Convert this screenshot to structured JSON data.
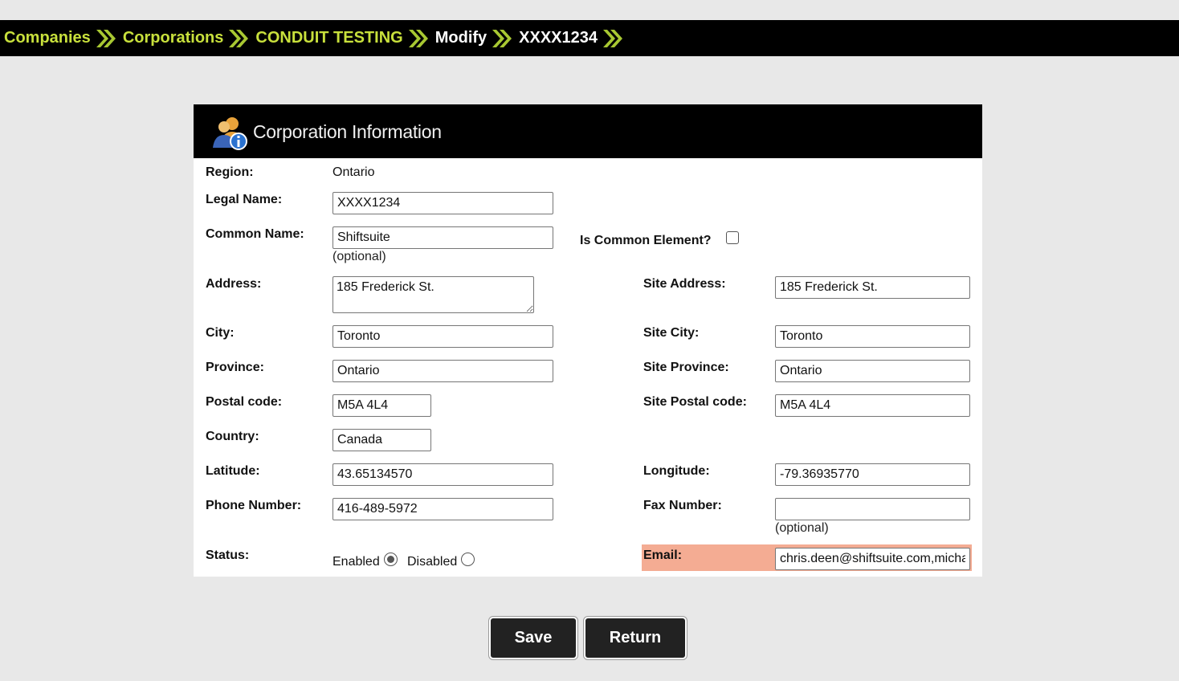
{
  "breadcrumb": [
    {
      "label": "Companies",
      "current": false
    },
    {
      "label": "Corporations",
      "current": false
    },
    {
      "label": "CONDUIT TESTING",
      "current": false
    },
    {
      "label": "Modify",
      "current": true
    },
    {
      "label": "XXXX1234",
      "current": true
    }
  ],
  "panel": {
    "title": "Corporation Information",
    "icon": "corporation-info-icon"
  },
  "form": {
    "region": {
      "label": "Region:",
      "value": "Ontario"
    },
    "legal_name": {
      "label": "Legal Name:",
      "value": "XXXX1234"
    },
    "common_name": {
      "label": "Common Name:",
      "value": "Shiftsuite",
      "hint": "(optional)"
    },
    "is_common_element": {
      "label": "Is Common Element?",
      "checked": false
    },
    "address": {
      "label": "Address:",
      "value": "185 Frederick St."
    },
    "site_address": {
      "label": "Site Address:",
      "value": "185 Frederick St."
    },
    "city": {
      "label": "City:",
      "value": "Toronto"
    },
    "site_city": {
      "label": "Site City:",
      "value": "Toronto"
    },
    "province": {
      "label": "Province:",
      "value": "Ontario"
    },
    "site_province": {
      "label": "Site Province:",
      "value": "Ontario"
    },
    "postal_code": {
      "label": "Postal code:",
      "value": "M5A 4L4"
    },
    "site_postal_code": {
      "label": "Site Postal code:",
      "value": "M5A 4L4"
    },
    "country": {
      "label": "Country:",
      "value": "Canada"
    },
    "latitude": {
      "label": "Latitude:",
      "value": "43.65134570"
    },
    "longitude": {
      "label": "Longitude:",
      "value": "-79.36935770"
    },
    "phone": {
      "label": "Phone Number:",
      "value": "416-489-5972"
    },
    "fax": {
      "label": "Fax Number:",
      "value": "",
      "hint": "(optional)"
    },
    "status": {
      "label": "Status:",
      "enabled_label": "Enabled",
      "disabled_label": "Disabled",
      "selected": "Enabled"
    },
    "email": {
      "label": "Email:",
      "value": "chris.deen@shiftsuite.com,micha"
    }
  },
  "buttons": {
    "save": "Save",
    "return": "Return"
  },
  "colors": {
    "breadcrumb_link": "#c8e03c",
    "email_highlight": "#f4ac93",
    "button_bg": "#222222"
  }
}
